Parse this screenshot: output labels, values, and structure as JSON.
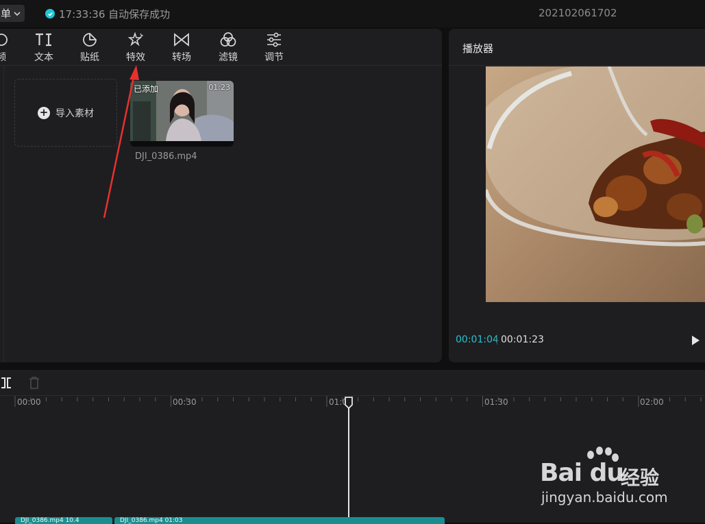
{
  "titlebar": {
    "menu_label": "单",
    "save_status": "17:33:36 自动保存成功",
    "project_name": "202102061702"
  },
  "toolbar": {
    "items": [
      {
        "label": "频",
        "icon": "media-icon"
      },
      {
        "label": "文本",
        "icon": "text-icon"
      },
      {
        "label": "贴纸",
        "icon": "sticker-icon"
      },
      {
        "label": "特效",
        "icon": "effects-icon"
      },
      {
        "label": "转场",
        "icon": "transition-icon"
      },
      {
        "label": "滤镜",
        "icon": "filter-icon"
      },
      {
        "label": "调节",
        "icon": "adjust-icon"
      }
    ]
  },
  "media": {
    "import_label": "导入素材",
    "item": {
      "badge": "已添加",
      "duration": "01:23",
      "filename": "DJI_0386.mp4"
    }
  },
  "player": {
    "title": "播放器",
    "current_time": "00:01:04",
    "total_time": "00:01:23"
  },
  "timeline": {
    "ruler": [
      "00:00",
      "00:30",
      "01:0",
      "01:30",
      "02:00"
    ],
    "clips": [
      {
        "label": "DJI_0386.mp4 10.4"
      },
      {
        "label": "DJI_0386.mp4 01:03"
      }
    ]
  },
  "watermark": {
    "logo": "Bai du",
    "brand": "经验",
    "url": "jingyan.baidu.com"
  },
  "colors": {
    "accent": "#1ec8d2",
    "clip": "#1a8e8f",
    "annotation_arrow": "#e8312f"
  }
}
